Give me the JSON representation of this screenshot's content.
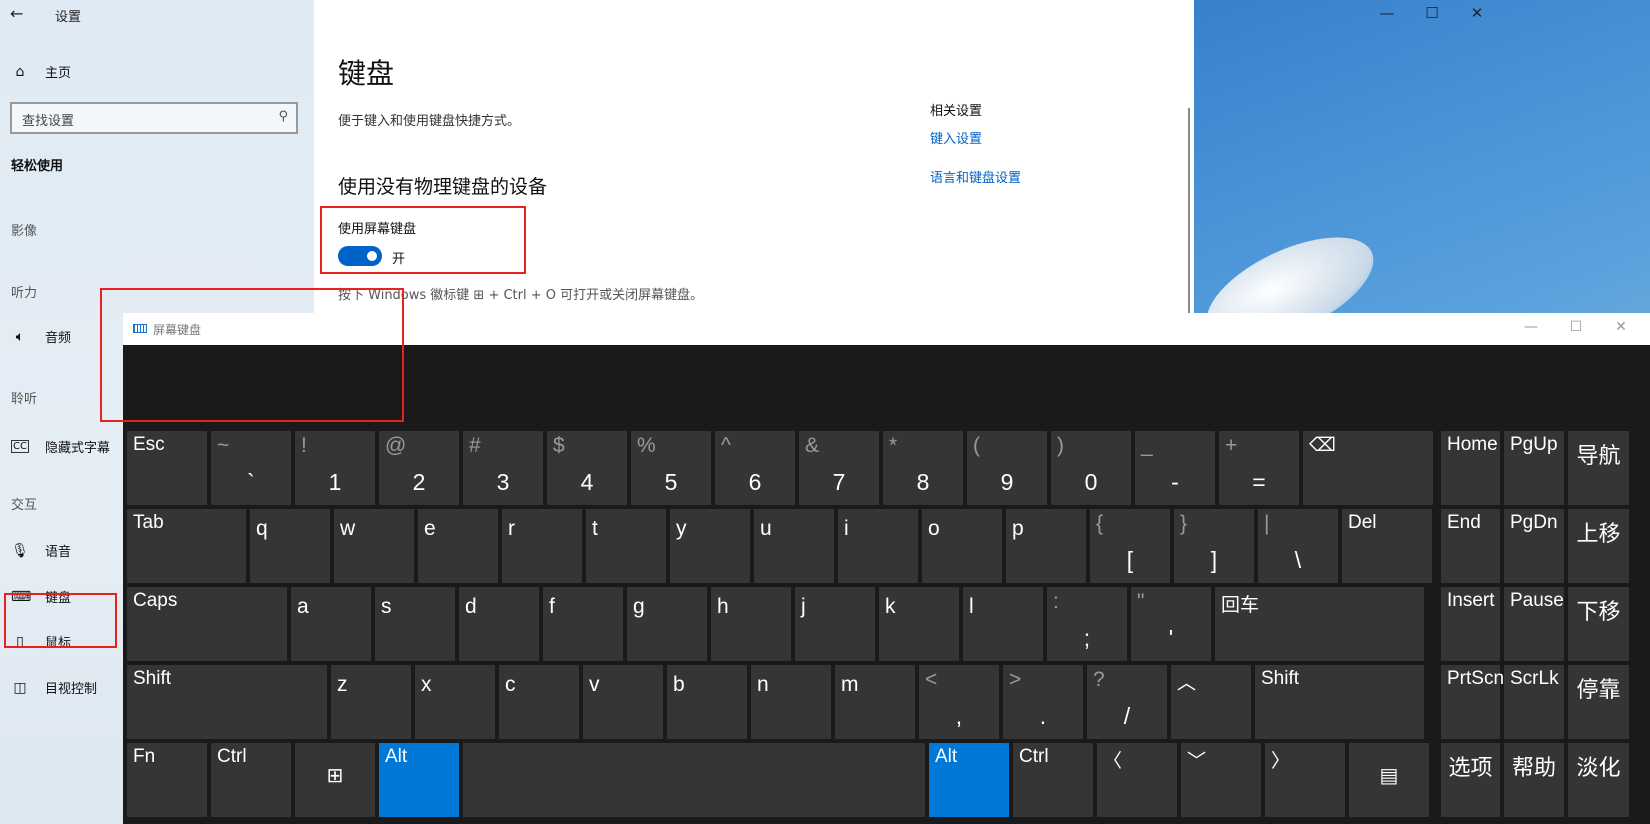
{
  "settings": {
    "back_icon": "back-arrow-icon",
    "title": "设置",
    "home": "主页",
    "search_placeholder": "查找设置",
    "category": "轻松使用",
    "section_vision": "影像",
    "section_hearing": "听力",
    "item_audio": "音频",
    "section_listen": "聆听",
    "item_captions": "隐藏式字幕",
    "section_interaction": "交互",
    "item_speech": "语音",
    "item_keyboard": "键盘",
    "item_mouse": "鼠标",
    "item_eye": "目视控制"
  },
  "page": {
    "title": "键盘",
    "description": "便于键入和使用键盘快捷方式。",
    "section_title": "使用没有物理键盘的设备",
    "toggle_label": "使用屏幕键盘",
    "toggle_state": "开",
    "hint": "按下 Windows 徽标键 ⊞ + Ctrl + O 可打开或关闭屏幕键盘。",
    "related_title": "相关设置",
    "related_link1": "键入设置",
    "related_link2": "语言和键盘设置"
  },
  "window_controls": {
    "minimize": "—",
    "maximize": "☐",
    "close": "✕"
  },
  "osk": {
    "title": "屏幕键盘",
    "controls": {
      "minimize": "—",
      "maximize": "☐",
      "close": "✕"
    },
    "accent_color": "#0078d7",
    "key_color": "#353535",
    "rows": [
      [
        {
          "l": "Esc"
        },
        {
          "u": "~",
          "d": "`"
        },
        {
          "u": "!",
          "d": "1"
        },
        {
          "u": "@",
          "d": "2"
        },
        {
          "u": "#",
          "d": "3"
        },
        {
          "u": "$",
          "d": "4"
        },
        {
          "u": "%",
          "d": "5"
        },
        {
          "u": "^",
          "d": "6"
        },
        {
          "u": "&",
          "d": "7"
        },
        {
          "u": "*",
          "d": "8"
        },
        {
          "u": "(",
          "d": "9"
        },
        {
          "u": ")",
          "d": "0"
        },
        {
          "u": "_",
          "d": "-"
        },
        {
          "u": "+",
          "d": "="
        },
        {
          "l": "⌫"
        },
        {
          "l": "Home"
        },
        {
          "l": "PgUp"
        },
        {
          "l": "导航"
        }
      ],
      [
        {
          "l": "Tab"
        },
        {
          "l": "q"
        },
        {
          "l": "w"
        },
        {
          "l": "e"
        },
        {
          "l": "r"
        },
        {
          "l": "t"
        },
        {
          "l": "y"
        },
        {
          "l": "u"
        },
        {
          "l": "i"
        },
        {
          "l": "o"
        },
        {
          "l": "p"
        },
        {
          "u": "{",
          "d": "["
        },
        {
          "u": "}",
          "d": "]"
        },
        {
          "u": "|",
          "d": "\\"
        },
        {
          "l": "Del"
        },
        {
          "l": "End"
        },
        {
          "l": "PgDn"
        },
        {
          "l": "上移"
        }
      ],
      [
        {
          "l": "Caps"
        },
        {
          "l": "a"
        },
        {
          "l": "s"
        },
        {
          "l": "d"
        },
        {
          "l": "f"
        },
        {
          "l": "g"
        },
        {
          "l": "h"
        },
        {
          "l": "j"
        },
        {
          "l": "k"
        },
        {
          "l": "l"
        },
        {
          "u": ":",
          "d": ";"
        },
        {
          "u": "\"",
          "d": "'"
        },
        {
          "l": "回车"
        },
        {
          "l": "Insert"
        },
        {
          "l": "Pause"
        },
        {
          "l": "下移"
        }
      ],
      [
        {
          "l": "Shift"
        },
        {
          "l": "z"
        },
        {
          "l": "x"
        },
        {
          "l": "c"
        },
        {
          "l": "v"
        },
        {
          "l": "b"
        },
        {
          "l": "n"
        },
        {
          "l": "m"
        },
        {
          "u": "<",
          "d": ","
        },
        {
          "u": ">",
          "d": "."
        },
        {
          "u": "?",
          "d": "/"
        },
        {
          "l": "︿"
        },
        {
          "l": "Shift"
        },
        {
          "l": "PrtScn"
        },
        {
          "l": "ScrLk"
        },
        {
          "l": "停靠"
        }
      ],
      [
        {
          "l": "Fn"
        },
        {
          "l": "Ctrl"
        },
        {
          "c": "⊞"
        },
        {
          "l": "Alt",
          "blue": true
        },
        {
          "l": ""
        },
        {
          "l": "Alt",
          "blue": true
        },
        {
          "l": "Ctrl"
        },
        {
          "l": "〈"
        },
        {
          "l": "﹀"
        },
        {
          "l": "〉"
        },
        {
          "c": "▤"
        },
        {
          "l": "选项"
        },
        {
          "l": "帮助"
        },
        {
          "l": "淡化"
        }
      ]
    ]
  }
}
